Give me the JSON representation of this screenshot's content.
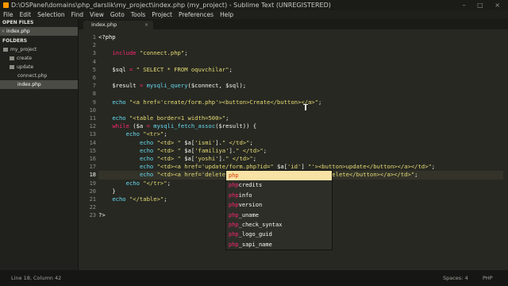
{
  "window": {
    "title": "D:\\OSPanel\\domains\\php_darslik\\my_project\\index.php (my_project) - Sublime Text (UNREGISTERED)"
  },
  "menu": [
    "File",
    "Edit",
    "Selection",
    "Find",
    "View",
    "Goto",
    "Tools",
    "Project",
    "Preferences",
    "Help"
  ],
  "sidebar": {
    "open_files_header": "OPEN FILES",
    "open_files": [
      "index.php"
    ],
    "folders_header": "FOLDERS",
    "tree": [
      {
        "label": "my_project",
        "kind": "folder"
      },
      {
        "label": "create",
        "kind": "folder"
      },
      {
        "label": "update",
        "kind": "folder"
      },
      {
        "label": "connect.php",
        "kind": "file"
      },
      {
        "label": "index.php",
        "kind": "file"
      }
    ]
  },
  "tab": {
    "label": "index.php",
    "close": "×"
  },
  "editor": {
    "current_line": 18,
    "lines": [
      [
        [
          "p",
          "<?php"
        ]
      ],
      [],
      [
        [
          "p",
          "    "
        ],
        [
          "k",
          "include"
        ],
        [
          "p",
          " "
        ],
        [
          "s",
          "\"connect.php\""
        ],
        [
          "p",
          ";"
        ]
      ],
      [],
      [
        [
          "p",
          "    "
        ],
        [
          "v",
          "$sql"
        ],
        [
          "p",
          " "
        ],
        [
          "k",
          "="
        ],
        [
          "p",
          " "
        ],
        [
          "s",
          "\" SELECT * FROM oquvchilar\""
        ],
        [
          "p",
          ";"
        ]
      ],
      [],
      [
        [
          "p",
          "    "
        ],
        [
          "v",
          "$result"
        ],
        [
          "p",
          " "
        ],
        [
          "k",
          "="
        ],
        [
          "p",
          " "
        ],
        [
          "f",
          "mysqli_query"
        ],
        [
          "p",
          "($connect, $sql);"
        ]
      ],
      [],
      [
        [
          "p",
          "    "
        ],
        [
          "f",
          "echo"
        ],
        [
          "p",
          " "
        ],
        [
          "s",
          "\"<a href='create/form.php'><button>Create</button></a>\""
        ],
        [
          "p",
          ";"
        ]
      ],
      [],
      [
        [
          "p",
          "    "
        ],
        [
          "f",
          "echo"
        ],
        [
          "p",
          " "
        ],
        [
          "s",
          "\"<table border=1 width=500>\""
        ],
        [
          "p",
          ";"
        ]
      ],
      [
        [
          "p",
          "    "
        ],
        [
          "k",
          "while"
        ],
        [
          "p",
          " ($a "
        ],
        [
          "k",
          "="
        ],
        [
          "p",
          " "
        ],
        [
          "f",
          "mysqli_fetch_assoc"
        ],
        [
          "p",
          "($result)) {"
        ]
      ],
      [
        [
          "p",
          "        "
        ],
        [
          "f",
          "echo"
        ],
        [
          "p",
          " "
        ],
        [
          "s",
          "\"<tr>\""
        ],
        [
          "p",
          ";"
        ]
      ],
      [
        [
          "p",
          "            "
        ],
        [
          "f",
          "echo"
        ],
        [
          "p",
          " "
        ],
        [
          "s",
          "\"<td> \""
        ],
        [
          "p",
          " $a["
        ],
        [
          "s",
          "'ismi'"
        ],
        [
          "p",
          "]."
        ],
        [
          "s",
          "\" </td>\""
        ],
        [
          "p",
          ";"
        ]
      ],
      [
        [
          "p",
          "            "
        ],
        [
          "f",
          "echo"
        ],
        [
          "p",
          " "
        ],
        [
          "s",
          "\"<td> \""
        ],
        [
          "p",
          " $a["
        ],
        [
          "s",
          "'familiya'"
        ],
        [
          "p",
          "]."
        ],
        [
          "s",
          "\" </td>\""
        ],
        [
          "p",
          ";"
        ]
      ],
      [
        [
          "p",
          "            "
        ],
        [
          "f",
          "echo"
        ],
        [
          "p",
          " "
        ],
        [
          "s",
          "\"<td> \""
        ],
        [
          "p",
          " $a["
        ],
        [
          "s",
          "'yoshi'"
        ],
        [
          "p",
          "]."
        ],
        [
          "s",
          "\" </td>\""
        ],
        [
          "p",
          ";"
        ]
      ],
      [
        [
          "p",
          "            "
        ],
        [
          "f",
          "echo"
        ],
        [
          "p",
          " "
        ],
        [
          "s",
          "\"<td><a href='update/form.php?id=\""
        ],
        [
          "p",
          " $a["
        ],
        [
          "s",
          "'id'"
        ],
        [
          "p",
          "] "
        ],
        [
          "s",
          "\"'><button>update</button></a></td>\""
        ],
        [
          "p",
          ";"
        ]
      ],
      [
        [
          "p",
          "            "
        ],
        [
          "f",
          "echo"
        ],
        [
          "p",
          " "
        ],
        [
          "s",
          "\"<td><a href='delete.php?id=\""
        ],
        [
          "p",
          " $a["
        ],
        [
          "s",
          "'id'"
        ],
        [
          "p",
          "] "
        ],
        [
          "s",
          "\"'><button>delete</button></a></td>\""
        ],
        [
          "p",
          ";"
        ]
      ],
      [
        [
          "p",
          "        "
        ],
        [
          "f",
          "echo"
        ],
        [
          "p",
          " "
        ],
        [
          "s",
          "\"</tr>\""
        ],
        [
          "p",
          ";"
        ]
      ],
      [
        [
          "p",
          "    }"
        ]
      ],
      [
        [
          "p",
          "    "
        ],
        [
          "f",
          "echo"
        ],
        [
          "p",
          " "
        ],
        [
          "s",
          "\"</table>\""
        ],
        [
          "p",
          ";"
        ]
      ],
      [],
      [
        [
          "p",
          "?>"
        ]
      ]
    ]
  },
  "autocomplete": {
    "typed": "php",
    "items": [
      "php",
      "phpcredits",
      "phpinfo",
      "phpversion",
      "php_uname",
      "php_check_syntax",
      "php_logo_guid",
      "php_sapi_name"
    ]
  },
  "status": {
    "position": "Line 18, Column 42",
    "indent": "Spaces: 4",
    "syntax": "PHP"
  }
}
